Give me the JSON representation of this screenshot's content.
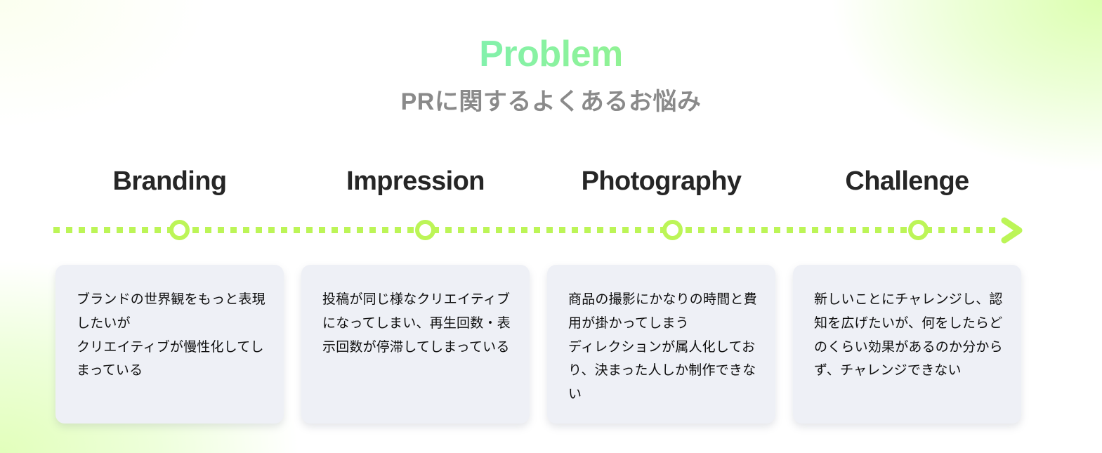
{
  "header": {
    "title": "Problem",
    "subtitle": "PRに関するよくあるお悩み",
    "title_gradient_from": "#65efd6",
    "title_gradient_to": "#b9f750",
    "subtitle_color": "#8a8a8a"
  },
  "timeline": {
    "accent_color": "#bcf557",
    "arrow_icon": "chevron-right-icon",
    "node_count": 4
  },
  "columns": [
    {
      "heading": "Branding",
      "card_text": "ブランドの世界観をもっと表現したいが\nクリエイティブが慢性化してしまっている"
    },
    {
      "heading": "Impression",
      "card_text": "投稿が同じ様なクリエイティブになってしまい、再生回数・表示回数が停滞してしまっている"
    },
    {
      "heading": "Photography",
      "card_text": "商品の撮影にかなりの時間と費用が掛かってしまう\nディレクションが属人化しており、決まった人しか制作できない"
    },
    {
      "heading": "Challenge",
      "card_text": "新しいことにチャレンジし、認知を広げたいが、何をしたらどのくらい効果があるのか分からず、チャレンジできない"
    }
  ],
  "theme": {
    "card_background": "#eef0f6",
    "card_text_color": "#0e0e0e",
    "heading_color": "#262626",
    "page_background": "#ffffff",
    "glow_color": "#dcffb0"
  }
}
